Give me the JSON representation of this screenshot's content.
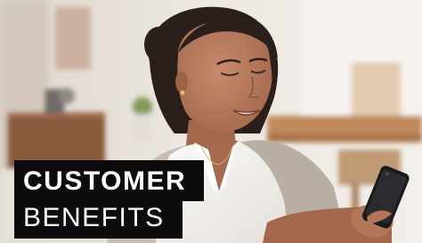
{
  "photo": {
    "icon": "woman-using-smartphone-photo",
    "colors": {
      "background": "#e9e3dc",
      "wall": "#f2eee9",
      "skin": "#b5775b",
      "hair": "#2a1f1b",
      "blouse": "#f7f5f2",
      "cardigan": "#c2b8ad",
      "phone": "#1a1a1d",
      "table_wood": "#c08a5b",
      "caption_bg": "#0d0b0c"
    }
  },
  "caption": {
    "line1": "CUSTOMER",
    "line2": "BENEFITS"
  }
}
